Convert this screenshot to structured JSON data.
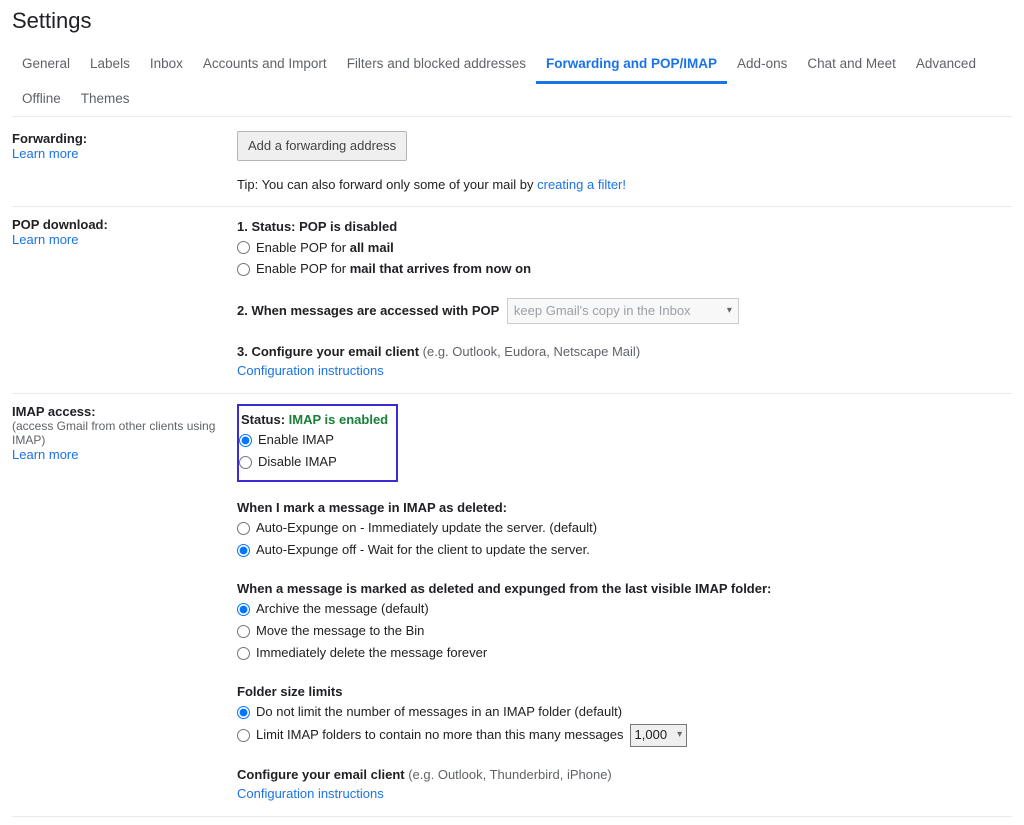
{
  "pageTitle": "Settings",
  "tabs": [
    "General",
    "Labels",
    "Inbox",
    "Accounts and Import",
    "Filters and blocked addresses",
    "Forwarding and POP/IMAP",
    "Add-ons",
    "Chat and Meet",
    "Advanced",
    "Offline",
    "Themes"
  ],
  "activeTabIndex": 5,
  "forwarding": {
    "label": "Forwarding:",
    "learnMore": "Learn more",
    "addButton": "Add a forwarding address",
    "tipPrefix": "Tip: You can also forward only some of your mail by ",
    "tipLink": "creating a filter!"
  },
  "pop": {
    "label": "POP download:",
    "learnMore": "Learn more",
    "status": {
      "prefix": "1. Status: ",
      "bold": "POP is disabled"
    },
    "opt1": {
      "prefix": "Enable POP for ",
      "bold": "all mail"
    },
    "opt2": {
      "prefix": "Enable POP for ",
      "bold": "mail that arrives from now on"
    },
    "accessedLabel": "2. When messages are accessed with POP",
    "dropdownText": "keep Gmail's copy in the Inbox",
    "configure": {
      "strong": "3. Configure your email client ",
      "muted": "(e.g. Outlook, Eudora, Netscape Mail)"
    },
    "configLink": "Configuration instructions"
  },
  "imap": {
    "label": "IMAP access:",
    "sublabel": "(access Gmail from other clients using IMAP)",
    "learnMore": "Learn more",
    "statusPrefix": "Status: ",
    "statusValue": "IMAP is enabled",
    "enable": "Enable IMAP",
    "disable": "Disable IMAP",
    "markDeletedHeader": "When I mark a message in IMAP as deleted:",
    "autoExpungeOn": "Auto-Expunge on - Immediately update the server. (default)",
    "autoExpungeOff": "Auto-Expunge off - Wait for the client to update the server.",
    "expungedHeader": "When a message is marked as deleted and expunged from the last visible IMAP folder:",
    "expOpt1": "Archive the message (default)",
    "expOpt2": "Move the message to the Bin",
    "expOpt3": "Immediately delete the message forever",
    "folderHeader": "Folder size limits",
    "folder1": "Do not limit the number of messages in an IMAP folder (default)",
    "folder2": "Limit IMAP folders to contain no more than this many messages",
    "folderLimit": "1,000",
    "configure": {
      "strong": "Configure your email client ",
      "muted": "(e.g. Outlook, Thunderbird, iPhone)"
    },
    "configLink": "Configuration instructions"
  }
}
